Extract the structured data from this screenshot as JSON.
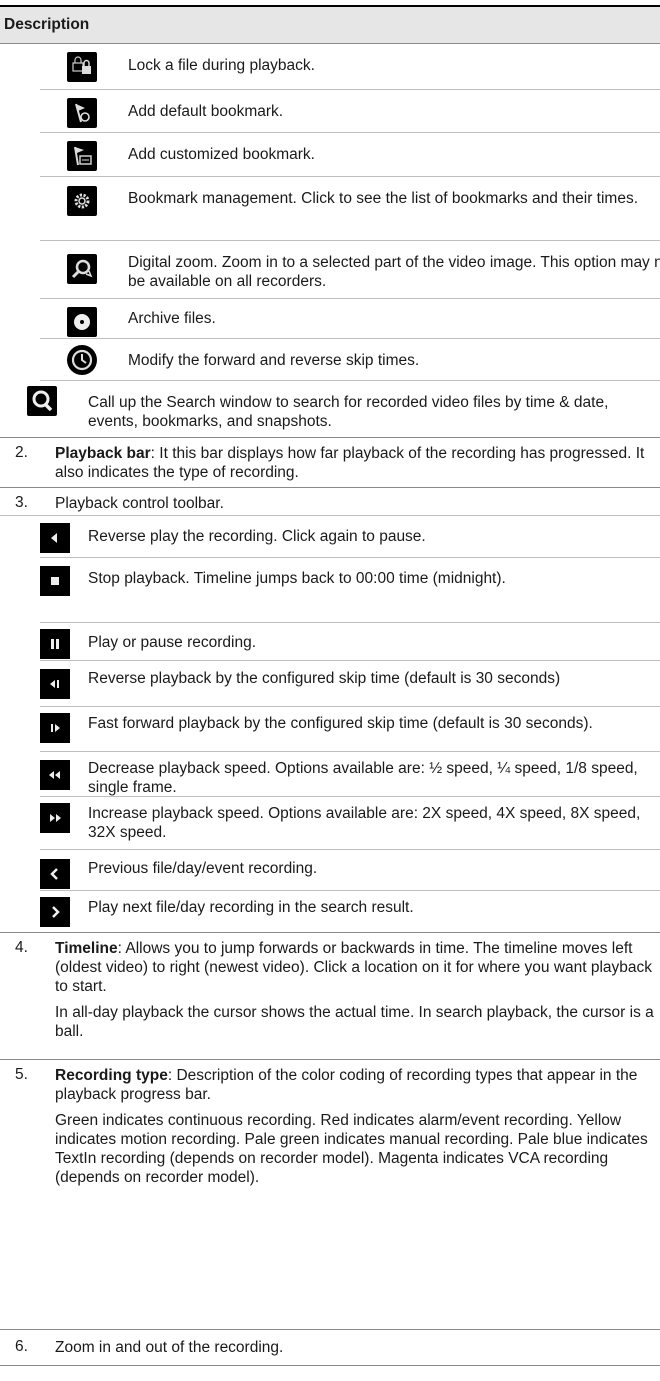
{
  "header": {
    "title": "Description"
  },
  "toolbar_items": [
    {
      "icon": "lock-file-icon",
      "text": "Lock a file during playback."
    },
    {
      "icon": "default-bookmark-icon",
      "text": "Add default bookmark."
    },
    {
      "icon": "custom-bookmark-icon",
      "text": "Add customized bookmark."
    },
    {
      "icon": "gear-icon",
      "text": "Bookmark management. Click to see the list of bookmarks and their times."
    },
    {
      "icon": "digital-zoom-icon",
      "text": "Digital zoom. Zoom in to a selected part of the video image. This option may not be available on all recorders."
    },
    {
      "icon": "archive-disc-icon",
      "text": "Archive files."
    },
    {
      "icon": "clock-icon",
      "text": "Modify the forward and reverse skip times."
    },
    {
      "icon": "search-icon",
      "text": "Call up the Search window to search for recorded video files by time & date, events, bookmarks, and snapshots."
    }
  ],
  "item2": {
    "number": "2.",
    "term": "Playback bar",
    "text": ": It this bar displays how far playback of the recording has progressed. It also indicates the type of recording."
  },
  "item3": {
    "number": "3.",
    "text": "Playback control toolbar."
  },
  "controls": [
    {
      "icon": "reverse-play-icon",
      "text": "Reverse play the recording. Click again to pause."
    },
    {
      "icon": "stop-icon",
      "text": "Stop playback. Timeline jumps back to 00:00 time (midnight)."
    },
    {
      "icon": "pause-icon",
      "text": "Play or pause recording."
    },
    {
      "icon": "skip-back-icon",
      "text": "Reverse playback by the configured skip time (default is 30 seconds)"
    },
    {
      "icon": "skip-forward-icon",
      "text": "Fast forward playback by the configured skip time (default is 30 seconds)."
    },
    {
      "icon": "decrease-speed-icon",
      "text": "Decrease playback speed. Options available are: ½ speed, ¼  speed, 1/8 speed, single frame."
    },
    {
      "icon": "increase-speed-icon",
      "text": "Increase playback speed. Options available are: 2X speed, 4X speed, 8X speed, 32X speed."
    },
    {
      "icon": "previous-icon",
      "text": "Previous file/day/event recording."
    },
    {
      "icon": "next-icon",
      "text": "Play next file/day recording in the search result."
    }
  ],
  "item4": {
    "number": "4.",
    "term": "Timeline",
    "text": ":  Allows you to jump forwards or backwards in time. The timeline moves left (oldest video) to right (newest video). Click a location on it for where you want playback to start.",
    "text2": "In all-day playback the cursor shows the actual time. In search playback, the cursor is a ball."
  },
  "item5": {
    "number": "5.",
    "term": "Recording type",
    "text": ": Description of the color coding of recording types that appear in the playback progress bar.",
    "text2": "Green indicates continuous recording. Red indicates alarm/event recording. Yellow indicates motion recording. Pale green indicates manual recording. Pale blue indicates TextIn recording (depends on recorder model). Magenta indicates VCA recording (depends on recorder model)."
  },
  "item6": {
    "number": "6.",
    "text": "Zoom in and out of the recording."
  }
}
